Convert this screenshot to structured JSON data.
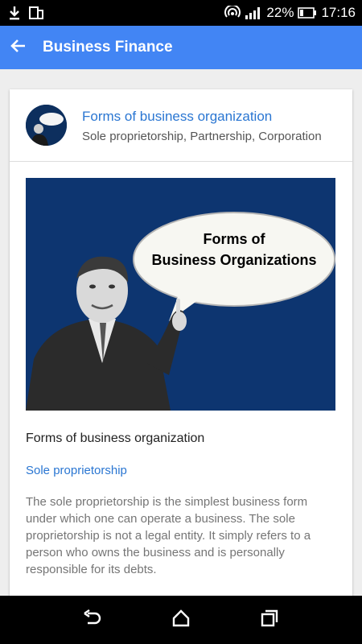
{
  "status_bar": {
    "battery_percent": "22%",
    "time": "17:16"
  },
  "app_bar": {
    "title": "Business Finance"
  },
  "card": {
    "title": "Forms of business organization",
    "subtitle": "Sole proprietorship, Partnership, Corporation",
    "hero_text_line1": "Forms of",
    "hero_text_line2": "Business Organizations",
    "section_title": "Forms of business organization",
    "link_text": "Sole proprietorship",
    "paragraph": "The sole proprietorship is the simplest business form under which one can operate a business. The sole proprietorship is not a legal entity. It simply refers to a person who owns the business and is personally responsible for its debts."
  },
  "colors": {
    "app_bar": "#4285f4",
    "link": "#2a76d2",
    "hero_bg": "#0d3570"
  },
  "icons": {
    "status_left": [
      "download-icon",
      "tablet-icon"
    ],
    "status_right": [
      "hotspot-icon",
      "signal-icon",
      "battery-icon"
    ],
    "nav": [
      "back-icon",
      "home-icon",
      "recents-icon"
    ]
  }
}
